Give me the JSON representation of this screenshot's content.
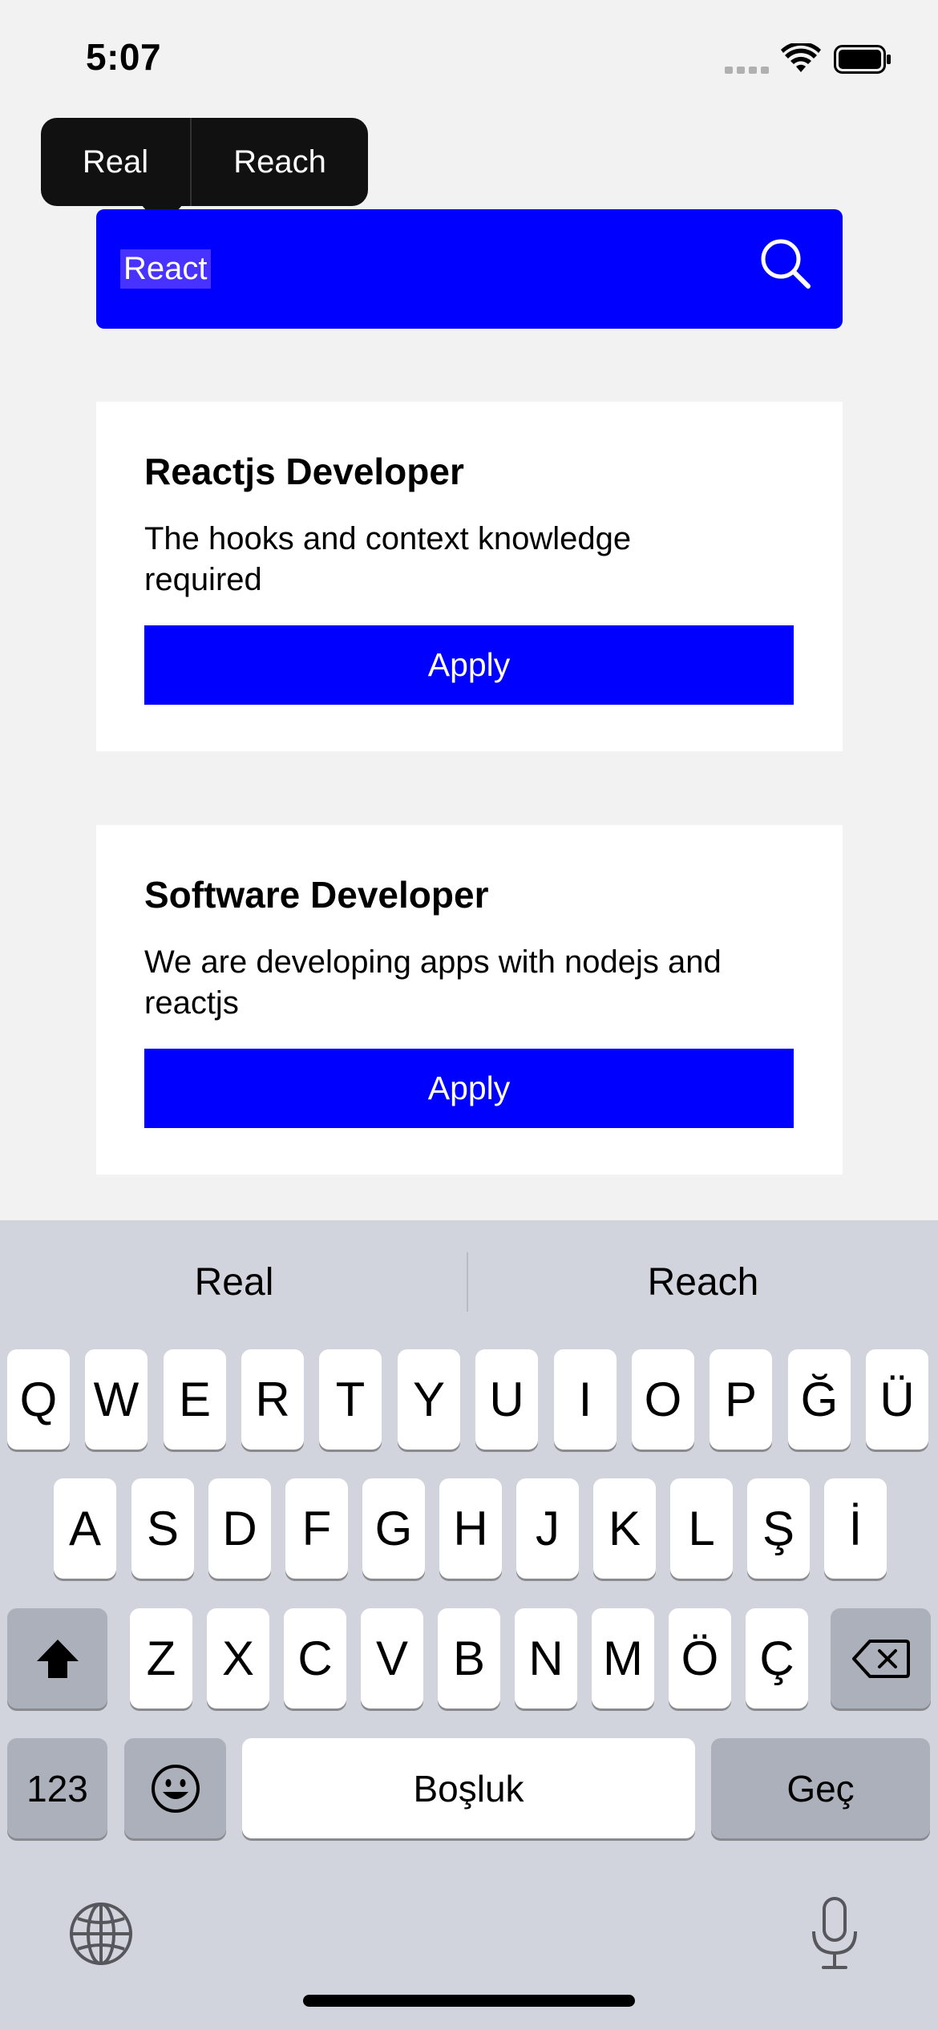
{
  "status_bar": {
    "time": "5:07"
  },
  "autocorrect_popover": {
    "options": [
      "Real",
      "Reach"
    ]
  },
  "search": {
    "value": "React"
  },
  "jobs": [
    {
      "title": "Reactjs Developer",
      "desc_line1": "The hooks and context knowledge",
      "desc_line2": "required",
      "apply_label": "Apply"
    },
    {
      "title": "Software Developer",
      "desc_line1": "We are developing apps with nodejs and",
      "desc_line2": "reactjs",
      "apply_label": "Apply"
    }
  ],
  "keyboard": {
    "suggestions": [
      "Real",
      "Reach"
    ],
    "row1": [
      "Q",
      "W",
      "E",
      "R",
      "T",
      "Y",
      "U",
      "I",
      "O",
      "P",
      "Ğ",
      "Ü"
    ],
    "row2": [
      "A",
      "S",
      "D",
      "F",
      "G",
      "H",
      "J",
      "K",
      "L",
      "Ş",
      "İ"
    ],
    "row3": [
      "Z",
      "X",
      "C",
      "V",
      "B",
      "N",
      "M",
      "Ö",
      "Ç"
    ],
    "numbers_label": "123",
    "space_label": "Boşluk",
    "return_label": "Geç"
  },
  "colors": {
    "accent": "#0000ff",
    "background": "#f2f2f2",
    "keyboard_bg": "#d1d4dc"
  }
}
